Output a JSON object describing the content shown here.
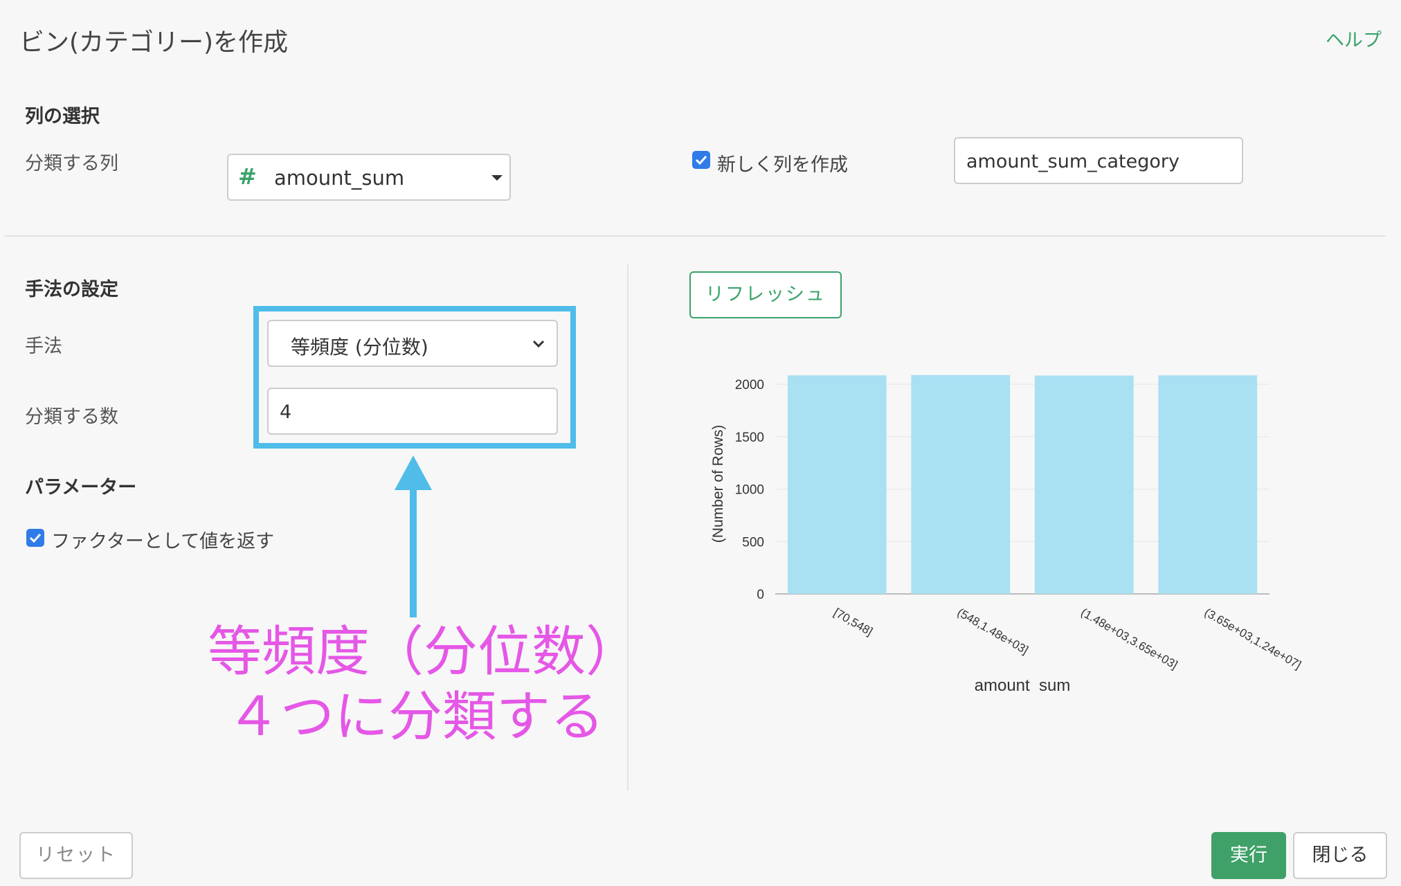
{
  "header": {
    "title": "ビン(カテゴリー)を作成",
    "help": "ヘルプ"
  },
  "column_selection": {
    "heading": "列の選択",
    "label": "分類する列",
    "type_icon": "#",
    "selected_column": "amount_sum",
    "new_column_checkbox_label": "新しく列を作成",
    "new_column_checked": true,
    "new_column_name": "amount_sum_category"
  },
  "method_settings": {
    "heading": "手法の設定",
    "method_label": "手法",
    "method_value": "等頻度 (分位数)",
    "count_label": "分類する数",
    "count_value": "4"
  },
  "parameters": {
    "heading": "パラメーター",
    "factor_label": "ファクターとして値を返す",
    "factor_checked": true
  },
  "annotation": {
    "line1": "等頻度（分位数）",
    "line2": "４つに分類する"
  },
  "preview": {
    "refresh": "リフレッシュ"
  },
  "footer": {
    "reset": "リセット",
    "run": "実行",
    "close": "閉じる"
  },
  "colors": {
    "accent_green": "#3aa36a",
    "highlight_blue": "#4fbce9",
    "annotation_pink": "#e557e6",
    "bar": "#a9e0f2",
    "checkbox": "#2f7ce8"
  },
  "chart_data": {
    "type": "bar",
    "categories": [
      "[70,548]",
      "(548,1.48e+03]",
      "(1.48e+03,3.65e+03]",
      "(3.65e+03,1.24e+07]"
    ],
    "values": [
      2085,
      2088,
      2083,
      2085
    ],
    "xlabel": "amount_sum",
    "ylabel": "(Number of Rows)",
    "yticks": [
      0,
      500,
      1000,
      1500,
      2000
    ],
    "ylim": [
      0,
      2100
    ],
    "grid": true
  }
}
